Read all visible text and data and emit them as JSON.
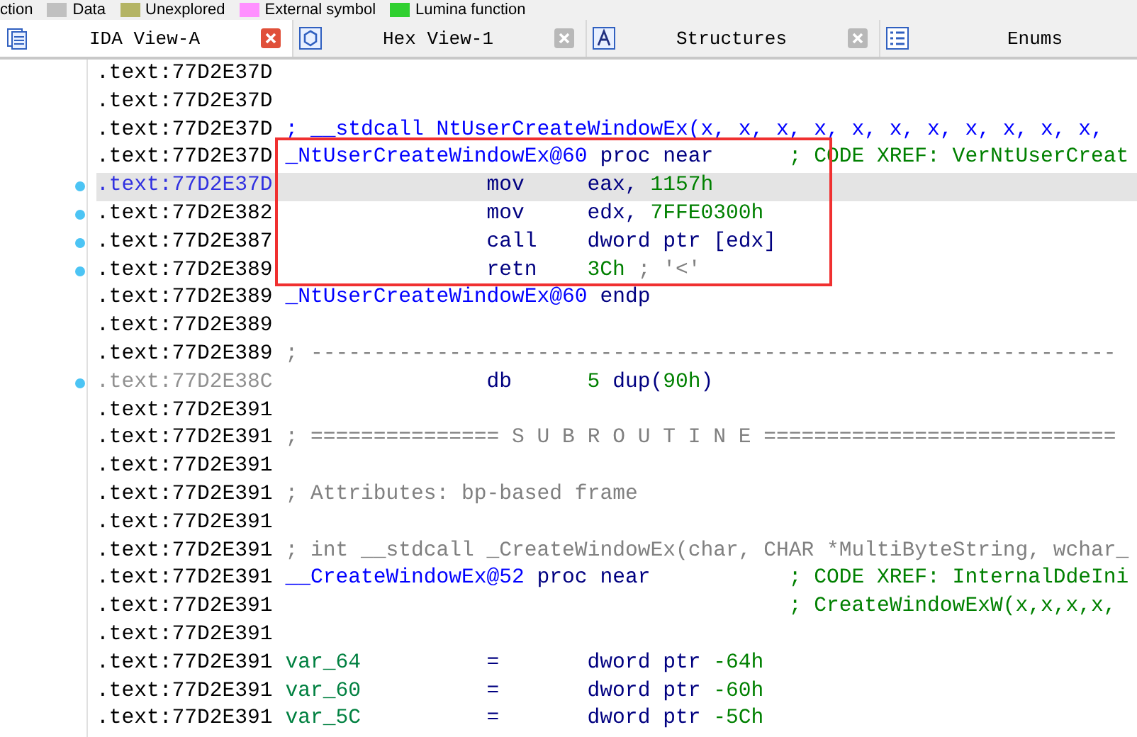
{
  "legend": [
    {
      "label": "ction"
    },
    {
      "label": "Data",
      "color": "#c0c0c0"
    },
    {
      "label": "Unexplored",
      "color": "#b4b464"
    },
    {
      "label": "External symbol",
      "color": "#ff90ff"
    },
    {
      "label": "Lumina function",
      "color": "#30d030"
    }
  ],
  "tabs": [
    {
      "label": "IDA View-A",
      "kind": "listing",
      "selected": true,
      "closable": true
    },
    {
      "label": "Hex View-1",
      "kind": "hex",
      "selected": false,
      "closable": true
    },
    {
      "label": "Structures",
      "kind": "struct",
      "selected": false,
      "closable": true
    },
    {
      "label": "Enums",
      "kind": "enum",
      "selected": false,
      "closable": false
    }
  ],
  "lines": [
    {
      "address": ".text:77D2E37D"
    },
    {
      "address": ".text:77D2E37D"
    },
    {
      "address": ".text:77D2E37D",
      "parts": [
        {
          "text": "; __stdcall NtUserCreateWindowEx(x, x, x, x, x, x, x, x, x, x, x,",
          "kind": "decl"
        }
      ]
    },
    {
      "address": ".text:77D2E37D",
      "boxed": true,
      "label": {
        "text": "_NtUserCreateWindowEx@60",
        "kind": "name"
      },
      "op": "proc near",
      "comment": [
        {
          "text": "; CODE XREF: VerNtUserCreat",
          "kind": "xref"
        }
      ]
    },
    {
      "address": ".text:77D2E37D",
      "boxed": true,
      "selected": true,
      "marker": true,
      "op": "mov",
      "parts": [
        {
          "text": "eax,",
          "kind": "operand"
        },
        {
          "text": "1157h",
          "kind": "number"
        }
      ]
    },
    {
      "address": ".text:77D2E382",
      "boxed": true,
      "marker": true,
      "op": "mov",
      "parts": [
        {
          "text": "edx,",
          "kind": "operand"
        },
        {
          "text": "7FFE0300h",
          "kind": "number"
        }
      ]
    },
    {
      "address": ".text:77D2E387",
      "boxed": true,
      "marker": true,
      "op": "call",
      "parts": [
        {
          "text": "dword ptr [edx]",
          "kind": "operand"
        }
      ]
    },
    {
      "address": ".text:77D2E389",
      "boxed": true,
      "marker": true,
      "op": "retn",
      "parts": [
        {
          "text": "3Ch",
          "kind": "number"
        },
        {
          "text": "; '<'",
          "kind": "comment"
        }
      ]
    },
    {
      "address": ".text:77D2E389",
      "label": {
        "text": "_NtUserCreateWindowEx@60",
        "kind": "name"
      },
      "op": "endp"
    },
    {
      "address": ".text:77D2E389"
    },
    {
      "address": ".text:77D2E389",
      "parts": [
        {
          "text": "; ----------------------------------------------------------------",
          "kind": "comment"
        }
      ]
    },
    {
      "address": ".text:77D2E38C",
      "dim": true,
      "marker": true,
      "op": "db",
      "parts": [
        {
          "text": "5",
          "kind": "number"
        },
        {
          "text": "dup(",
          "kind": "operand"
        },
        {
          "text": "90h",
          "kind": "number"
        },
        {
          "text": ")",
          "kind": "operand"
        }
      ]
    },
    {
      "address": ".text:77D2E391"
    },
    {
      "address": ".text:77D2E391",
      "parts": [
        {
          "text": "; =============== S U B R O U T I N E ============================",
          "kind": "comment"
        }
      ]
    },
    {
      "address": ".text:77D2E391"
    },
    {
      "address": ".text:77D2E391",
      "parts": [
        {
          "text": "; Attributes: bp-based frame",
          "kind": "comment"
        }
      ]
    },
    {
      "address": ".text:77D2E391"
    },
    {
      "address": ".text:77D2E391",
      "parts": [
        {
          "text": "; int __stdcall _CreateWindowEx(char, CHAR *MultiByteString, wchar_",
          "kind": "comment"
        }
      ]
    },
    {
      "address": ".text:77D2E391",
      "label": {
        "text": "__CreateWindowEx@52",
        "kind": "name"
      },
      "op": "proc near",
      "comment": [
        {
          "text": "; CODE XREF: InternalDdeIni",
          "kind": "xref"
        }
      ]
    },
    {
      "address": ".text:77D2E391",
      "comment": [
        {
          "text": "; CreateWindowExW(x,x,x,x,",
          "kind": "xref"
        }
      ]
    },
    {
      "address": ".text:77D2E391"
    },
    {
      "address": ".text:77D2E391",
      "label": {
        "text": "var_64",
        "kind": "var"
      },
      "op": "=",
      "parts": [
        {
          "text": "dword ptr",
          "kind": "operand"
        },
        {
          "text": "-64h",
          "kind": "number"
        }
      ]
    },
    {
      "address": ".text:77D2E391",
      "label": {
        "text": "var_60",
        "kind": "var"
      },
      "op": "=",
      "parts": [
        {
          "text": "dword ptr",
          "kind": "operand"
        },
        {
          "text": "-60h",
          "kind": "number"
        }
      ]
    },
    {
      "address": ".text:77D2E391",
      "label": {
        "text": "var_5C",
        "kind": "var"
      },
      "op": "=",
      "parts": [
        {
          "text": "dword ptr",
          "kind": "operand"
        },
        {
          "text": "-5Ch",
          "kind": "number"
        }
      ]
    }
  ]
}
